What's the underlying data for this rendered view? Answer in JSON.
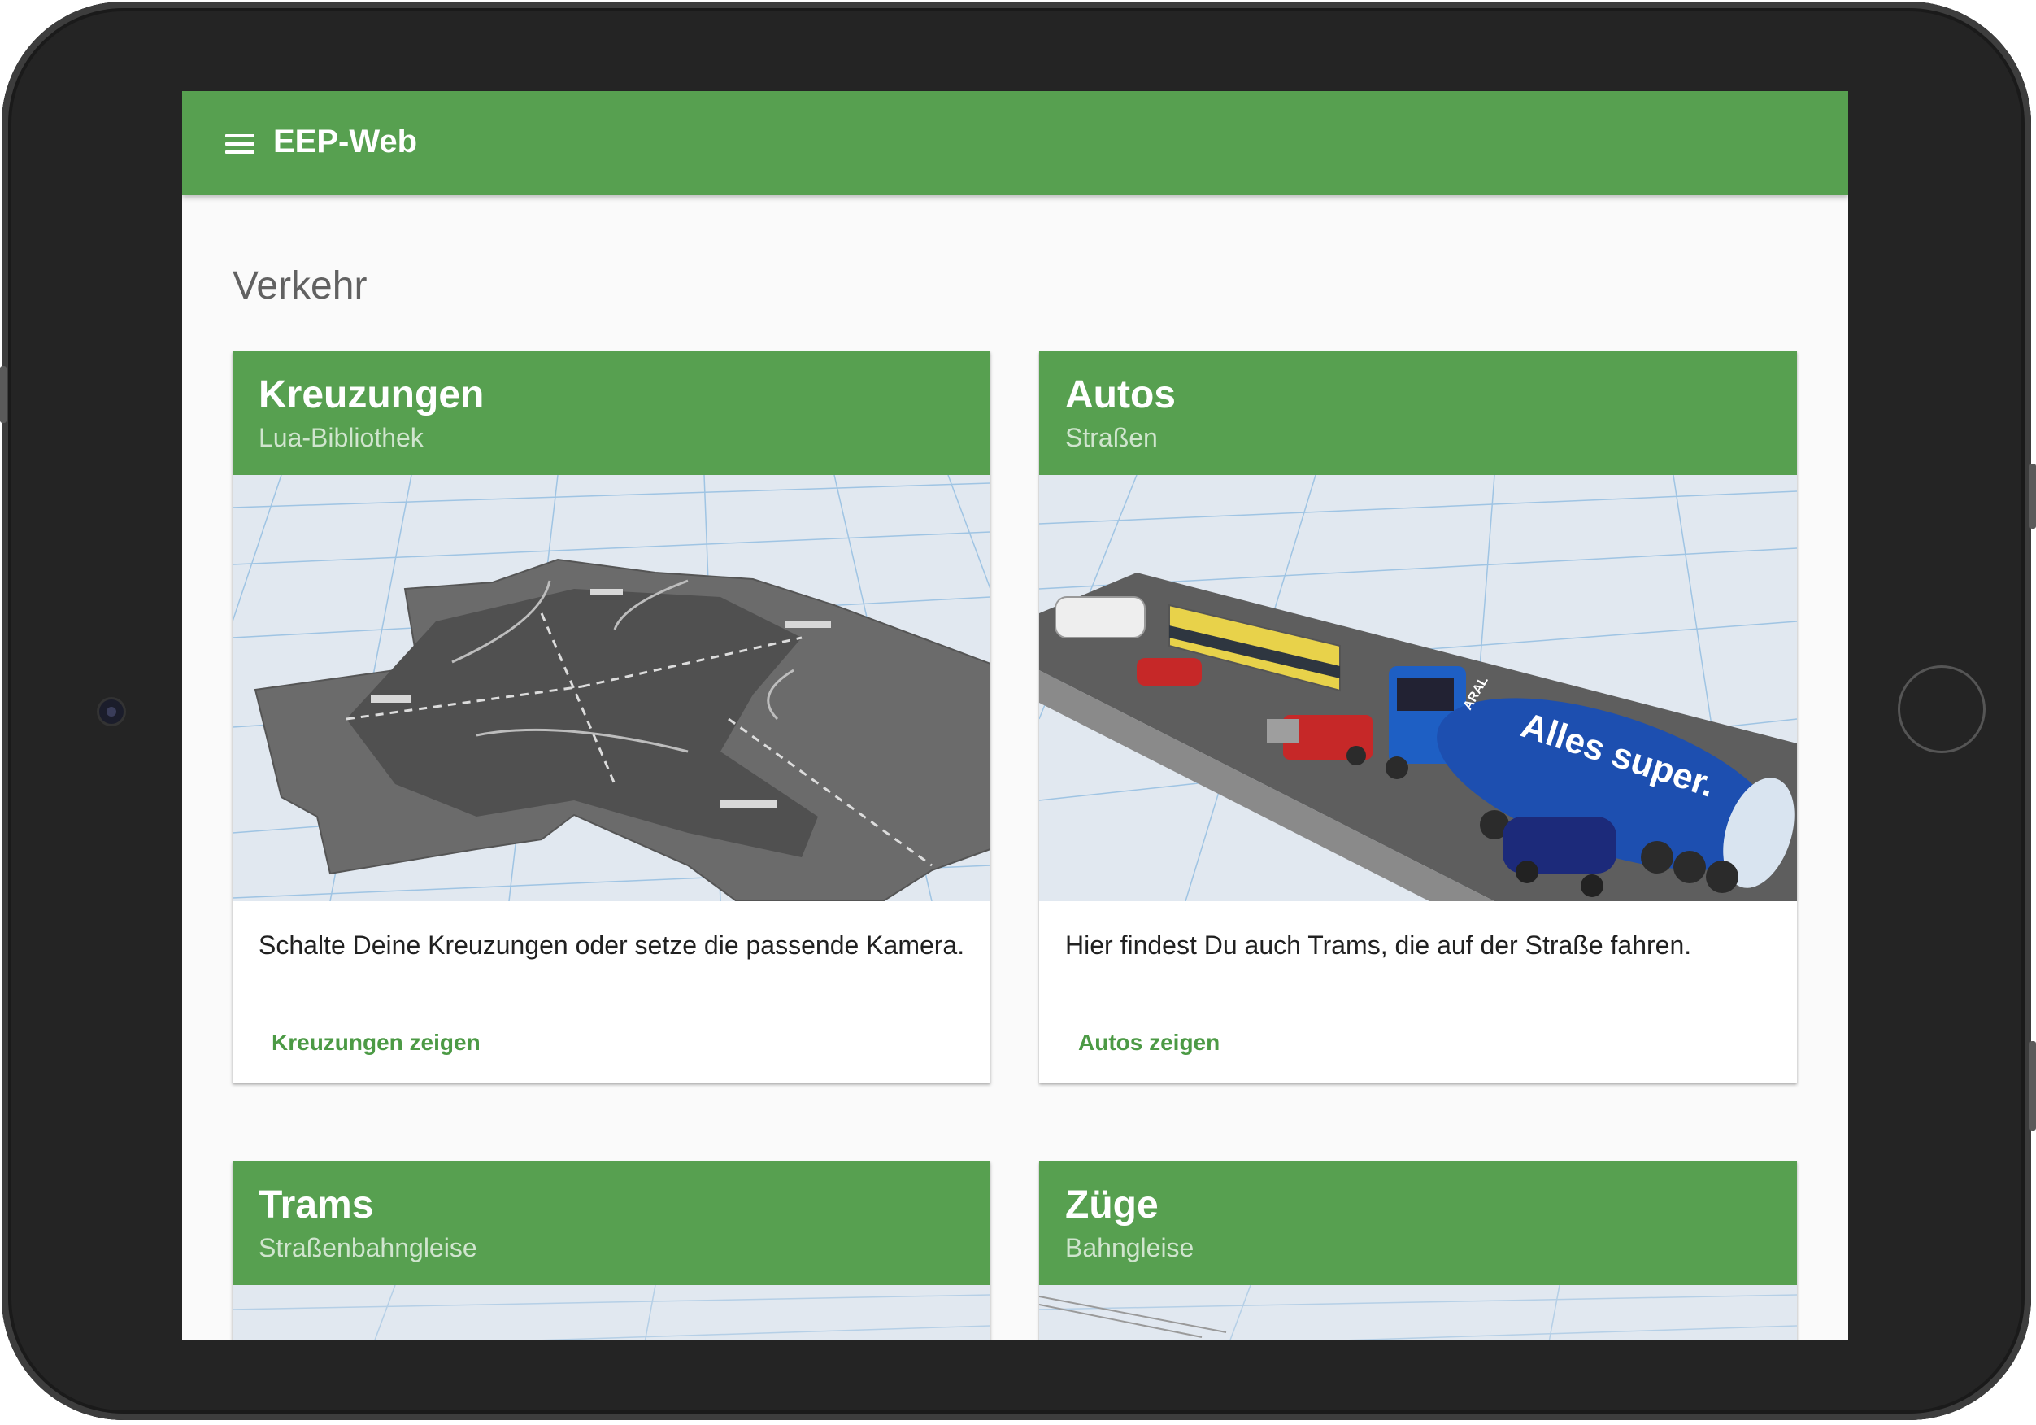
{
  "app": {
    "title": "EEP-Web",
    "primary_color": "#57a050"
  },
  "section": {
    "title": "Verkehr"
  },
  "cards": [
    {
      "title": "Kreuzungen",
      "subtitle": "Lua-Bibliothek",
      "image": "road-intersection-render",
      "text": "Schalte Deine Kreuzungen oder setze die passende Kamera.",
      "action": "Kreuzungen zeigen"
    },
    {
      "title": "Autos",
      "subtitle": "Straßen",
      "image": "road-vehicles-render",
      "image_lettering": [
        "ARAL",
        "Alles super."
      ],
      "text": "Hier findest Du auch Trams, die auf der Straße fahren.",
      "action": "Autos zeigen"
    },
    {
      "title": "Trams",
      "subtitle": "Straßenbahngleise",
      "image": "tram-tracks-render"
    },
    {
      "title": "Züge",
      "subtitle": "Bahngleise",
      "image": "railway-tracks-render"
    }
  ]
}
